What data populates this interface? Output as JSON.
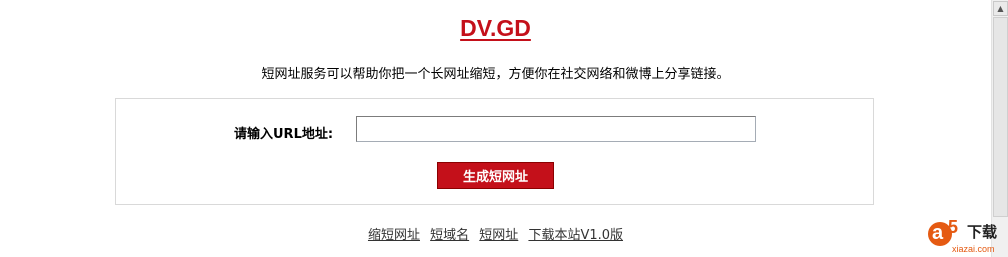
{
  "header": {
    "logo_text": "DV.GD",
    "tagline": "短网址服务可以帮助你把一个长网址缩短，方便你在社交网络和微博上分享链接。"
  },
  "form": {
    "url_label": "请输入URL地址:",
    "url_value": "",
    "submit_label": "生成短网址"
  },
  "footer": {
    "links": [
      {
        "label": "缩短网址"
      },
      {
        "label": "短域名"
      },
      {
        "label": "短网址"
      },
      {
        "label": "下载本站V1.0版"
      }
    ]
  },
  "watermark": {
    "a_letter": "a",
    "five": "5",
    "xiazai_label": "下载",
    "site": "xiazai.com"
  },
  "colors": {
    "accent_red": "#c4101a",
    "watermark_orange": "#e55a12"
  },
  "icons": {
    "scroll_up": "scroll-up-arrow-icon"
  }
}
